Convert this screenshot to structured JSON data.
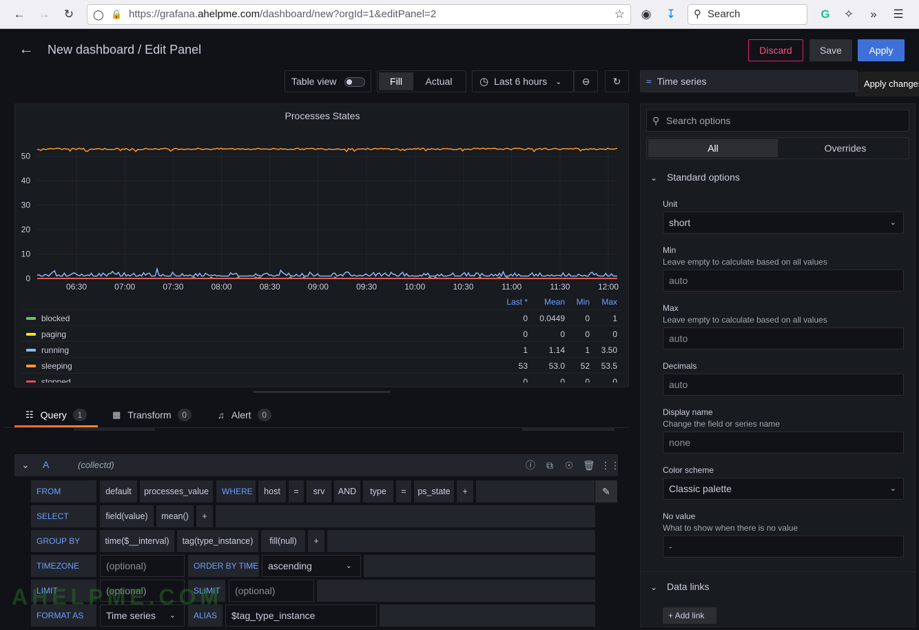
{
  "browser": {
    "url_prefix": "https://grafana.",
    "url_domain": "ahelpme.com",
    "url_path": "/dashboard/new?orgId=1&editPanel=2",
    "search_placeholder": "Search"
  },
  "header": {
    "title": "New dashboard / Edit Panel",
    "discard_label": "Discard",
    "save_label": "Save",
    "apply_label": "Apply",
    "tooltip": "Apply changes"
  },
  "toolbar": {
    "table_view_label": "Table view",
    "fill_label": "Fill",
    "actual_label": "Actual",
    "time_range": "Last 6 hours"
  },
  "visualization": {
    "type_label": "Time series"
  },
  "panel": {
    "title": "Processes States"
  },
  "chart_data": {
    "type": "line",
    "title": "Processes States",
    "x_ticks": [
      "06:30",
      "07:00",
      "07:30",
      "08:00",
      "08:30",
      "09:00",
      "09:30",
      "10:00",
      "10:30",
      "11:00",
      "11:30",
      "12:00"
    ],
    "y_ticks": [
      0,
      10,
      20,
      30,
      40,
      50
    ],
    "ylim": [
      0,
      55
    ],
    "grid": true,
    "legend_placement": "bottom",
    "series": [
      {
        "name": "blocked",
        "color": "#73bf69",
        "last": "0",
        "mean": "0.0449",
        "min": "0",
        "max": "1",
        "level": 0
      },
      {
        "name": "paging",
        "color": "#fade2a",
        "last": "0",
        "mean": "0",
        "min": "0",
        "max": "0",
        "level": 0
      },
      {
        "name": "running",
        "color": "#8ab8ff",
        "last": "1",
        "mean": "1.14",
        "min": "1",
        "max": "3.50",
        "level": 1.14
      },
      {
        "name": "sleeping",
        "color": "#ff9830",
        "last": "53",
        "mean": "53.0",
        "min": "52",
        "max": "53.5",
        "level": 53
      },
      {
        "name": "stopped",
        "color": "#f2495c",
        "last": "0",
        "mean": "0",
        "min": "0",
        "max": "0",
        "level": 0
      }
    ],
    "legend_headers": {
      "last": "Last *",
      "mean": "Mean",
      "min": "Min",
      "max": "Max"
    }
  },
  "tabs": {
    "query": {
      "label": "Query",
      "count": "1"
    },
    "transform": {
      "label": "Transform",
      "count": "0"
    },
    "alert": {
      "label": "Alert",
      "count": "0"
    }
  },
  "query": {
    "ref": "A",
    "datasource": "(collectd)",
    "from_kw": "FROM",
    "from_policy": "default",
    "from_measurement": "processes_value",
    "where_kw": "WHERE",
    "where_tag1": "host",
    "eq": "=",
    "where_val1": "srv",
    "and_kw": "AND",
    "where_tag2": "type",
    "where_val2": "ps_state",
    "plus": "+",
    "select_kw": "SELECT",
    "select_field": "field(value)",
    "select_fn": "mean()",
    "groupby_kw": "GROUP BY",
    "group_time": "time($__interval)",
    "group_tag": "tag(type_instance)",
    "group_fill": "fill(null)",
    "timezone_kw": "TIMEZONE",
    "optional": "(optional)",
    "orderby_kw": "ORDER BY TIME",
    "order_value": "ascending",
    "limit_kw": "LIMIT",
    "slimit_kw": "SLIMIT",
    "format_kw": "FORMAT AS",
    "format_value": "Time series",
    "alias_kw": "ALIAS",
    "alias_value": "$tag_type_instance"
  },
  "options": {
    "search_placeholder": "Search options",
    "tab_all": "All",
    "tab_overrides": "Overrides",
    "section_standard": "Standard options",
    "unit_label": "Unit",
    "unit_value": "short",
    "min_label": "Min",
    "min_desc": "Leave empty to calculate based on all values",
    "min_placeholder": "auto",
    "max_label": "Max",
    "max_desc": "Leave empty to calculate based on all values",
    "max_placeholder": "auto",
    "decimals_label": "Decimals",
    "decimals_placeholder": "auto",
    "display_name_label": "Display name",
    "display_name_desc": "Change the field or series name",
    "display_name_placeholder": "none",
    "color_scheme_label": "Color scheme",
    "color_scheme_value": "Classic palette",
    "no_value_label": "No value",
    "no_value_desc": "What to show when there is no value",
    "no_value_placeholder": "-",
    "section_links": "Data links",
    "add_link": "Add link"
  },
  "watermark": "AHELPME.COM"
}
